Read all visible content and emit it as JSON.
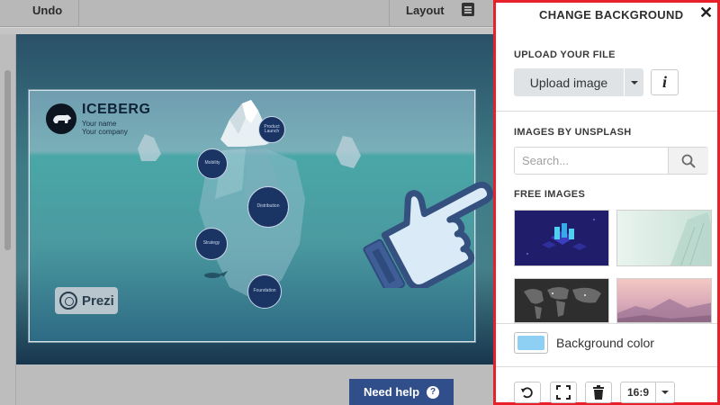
{
  "toolbar": {
    "undo_label": "Undo",
    "layout_label": "Layout"
  },
  "slide": {
    "title": "ICEBERG",
    "subtitle_name": "Your name",
    "subtitle_company": "Your company",
    "nodes": [
      "Product Launch",
      "Mobility",
      "Distribution",
      "Strategy",
      "Foundation"
    ],
    "logo_text": "Prezi"
  },
  "help": {
    "label": "Need help",
    "icon": "?"
  },
  "panel": {
    "title": "CHANGE BACKGROUND",
    "close_icon": "close-icon",
    "upload_section": "UPLOAD YOUR FILE",
    "upload_button": "Upload image",
    "info_label": "i",
    "unsplash_section": "IMAGES BY UNSPLASH",
    "search_placeholder": "Search...",
    "free_section": "FREE IMAGES",
    "thumbnails": [
      "server-isometric",
      "frosted-leaf",
      "world-map-dark",
      "pink-sunset-mountains"
    ],
    "bg_color_label": "Background color",
    "bg_color_value": "#8ed0f3",
    "ratio": "16:9"
  },
  "colors": {
    "highlight_border": "#e8202a",
    "help_button": "#304e8a"
  }
}
